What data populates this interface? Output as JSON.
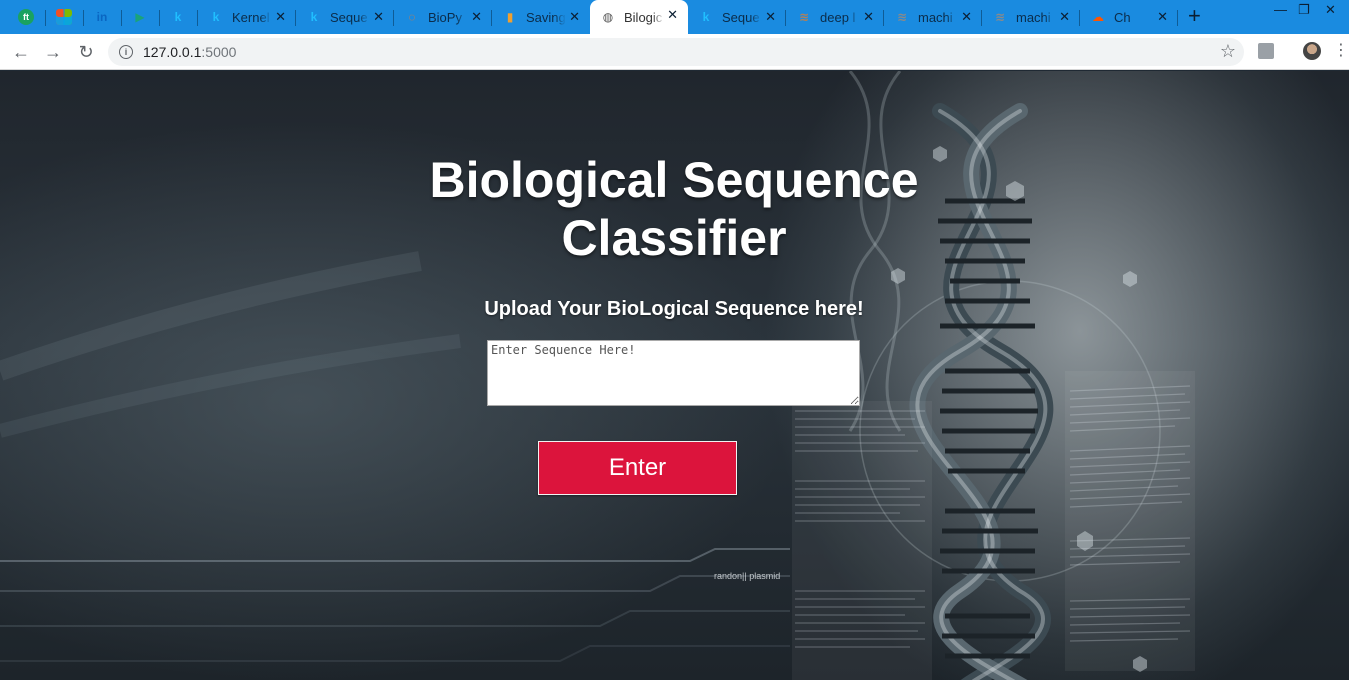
{
  "browser": {
    "tabs": [
      {
        "title": "",
        "favicon": "ft-icon",
        "favicon_text": "ft",
        "color": "#1aa260"
      },
      {
        "title": "",
        "favicon": "microsoft-icon",
        "favicon_text": "",
        "color": "#f25022"
      },
      {
        "title": "",
        "favicon": "linkedin-icon",
        "favicon_text": "in",
        "color": "#0a66c2"
      },
      {
        "title": "",
        "favicon": "play-icon",
        "favicon_text": "▶",
        "color": "#1aa37a"
      },
      {
        "title": "",
        "favicon": "kaggle-icon",
        "favicon_text": "k",
        "color": "#20beff"
      },
      {
        "title": "Kernel",
        "favicon": "kaggle-icon",
        "favicon_text": "k",
        "color": "#20beff"
      },
      {
        "title": "Seque",
        "favicon": "kaggle-icon",
        "favicon_text": "k",
        "color": "#20beff"
      },
      {
        "title": "BioPy",
        "favicon": "jupyter-icon",
        "favicon_text": "◌",
        "color": "#f37726"
      },
      {
        "title": "Saving",
        "favicon": "book-icon",
        "favicon_text": "▮",
        "color": "#f0a030"
      },
      {
        "title": "Bilogic",
        "favicon": "globe-icon",
        "favicon_text": "◍",
        "color": "#555555"
      },
      {
        "title": "Seque",
        "favicon": "kaggle-icon",
        "favicon_text": "k",
        "color": "#20beff"
      },
      {
        "title": "deep l",
        "favicon": "stack-icon",
        "favicon_text": "≋",
        "color": "#b0805a"
      },
      {
        "title": "machi",
        "favicon": "stack-icon",
        "favicon_text": "≋",
        "color": "#8a8a8a"
      },
      {
        "title": "machi",
        "favicon": "stack-icon",
        "favicon_text": "≋",
        "color": "#8a8a8a"
      },
      {
        "title": "Ch",
        "favicon": "soundcloud-icon",
        "favicon_text": "☁",
        "color": "#ff5500"
      }
    ],
    "active_tab_index": 9,
    "new_tab_label": "+",
    "address": {
      "host": "127.0.0.1",
      "port": ":5000"
    }
  },
  "page": {
    "title": "Biological Sequence Classifier",
    "subtitle": "Upload Your BioLogical Sequence here!",
    "sequence_input": {
      "placeholder": "Enter Sequence Here!",
      "value": ""
    },
    "submit_label": "Enter",
    "background_caption": "randon|| plasmid",
    "accent_color": "#dc143c"
  }
}
